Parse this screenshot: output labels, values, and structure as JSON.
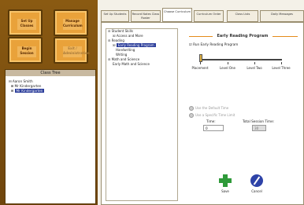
{
  "left_buttons": [
    {
      "label": "Set Up Classes",
      "enabled": true
    },
    {
      "label": "Manage Curriculum",
      "enabled": true
    },
    {
      "label": "Begin Session",
      "enabled": true
    },
    {
      "label": "Exit / Administration",
      "enabled": false
    }
  ],
  "class_tree": {
    "title": "Class Tree",
    "items": [
      "Aaron Smith",
      "Mr Kindergarten",
      "Mr Kindergarten"
    ]
  },
  "tabs": [
    "Set Up Students",
    "Record Notes Class Roster",
    "Choose Curriculum",
    "Curriculum Order",
    "Class Lists",
    "Daily Messages"
  ],
  "active_tab": 2,
  "skills_tree": [
    "Student Skills",
    "Access and More",
    "Reading",
    "Early Reading Program",
    "Handwriting",
    "Writing",
    "Math and Science",
    "Early Math and Science"
  ],
  "program": {
    "title": "Early Reading Program",
    "enabled_label": "Run Early Reading Program",
    "levels": [
      "Placement",
      "Level One",
      "Level Two",
      "Level Three"
    ],
    "slider_value_index": 0,
    "radio1": "Use the Default Time",
    "radio2": "Use a Specific Time Limit",
    "time_label": "Time:",
    "time_value": "0",
    "total_label": "Total Session Time:",
    "total_value": "30"
  },
  "actions": {
    "save": "Save",
    "cancel": "Cancel"
  }
}
